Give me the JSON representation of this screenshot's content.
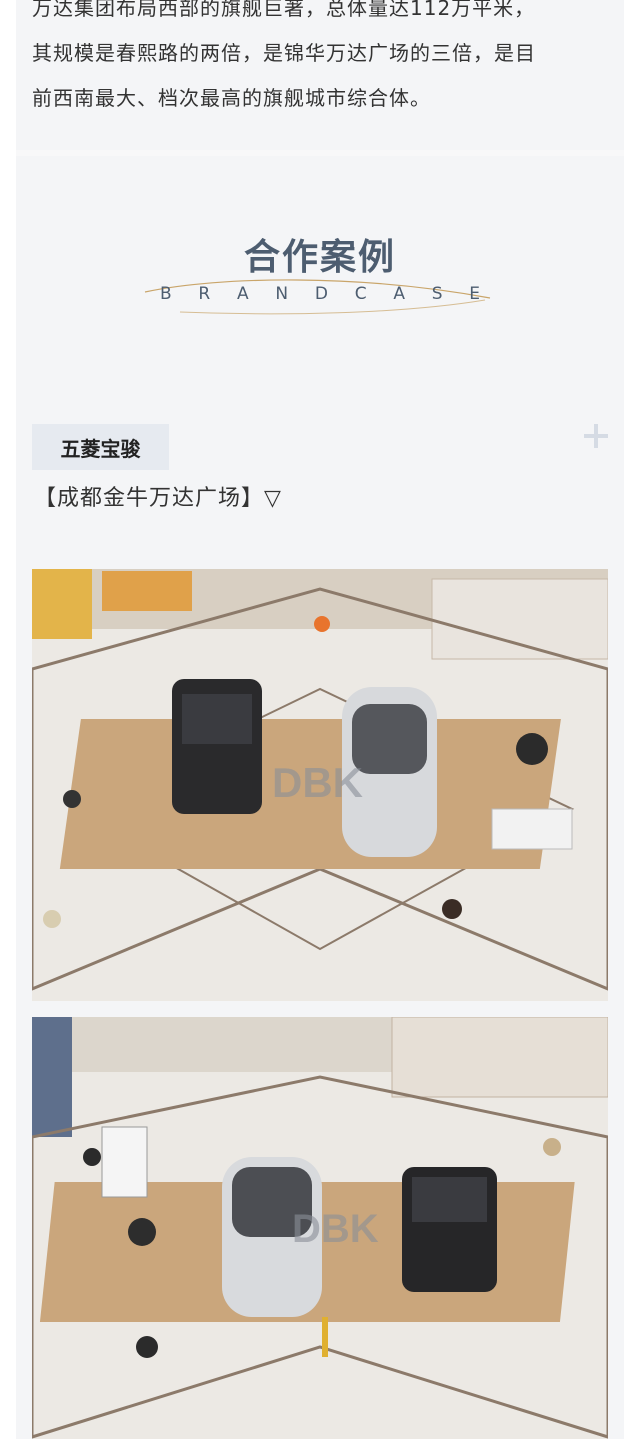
{
  "intro": {
    "lines": [
      "万达集团布局西部的旗舰巨著，总体量达112万平米，",
      "其规模是春熙路的两倍，是锦华万达广场的三倍，是目",
      "前西南最大、档次最高的旗舰城市综合体。"
    ]
  },
  "section": {
    "title": "合作案例",
    "subtitle_letters": [
      "B",
      "R",
      "A",
      "N",
      "D",
      "C",
      "A",
      "S",
      "E"
    ]
  },
  "brand": {
    "name": "五菱宝骏"
  },
  "location": "【成都金牛万达广场】▽",
  "photos": [
    {
      "icon": "mall-atrium-car-display-photo",
      "watermark": "DBK"
    },
    {
      "icon": "mall-atrium-car-display-photo",
      "watermark": "DBK"
    }
  ],
  "colors": {
    "title": "#4d5d70",
    "badge_bg": "#e6eaf0",
    "card_bg": "#f4f5f7"
  }
}
